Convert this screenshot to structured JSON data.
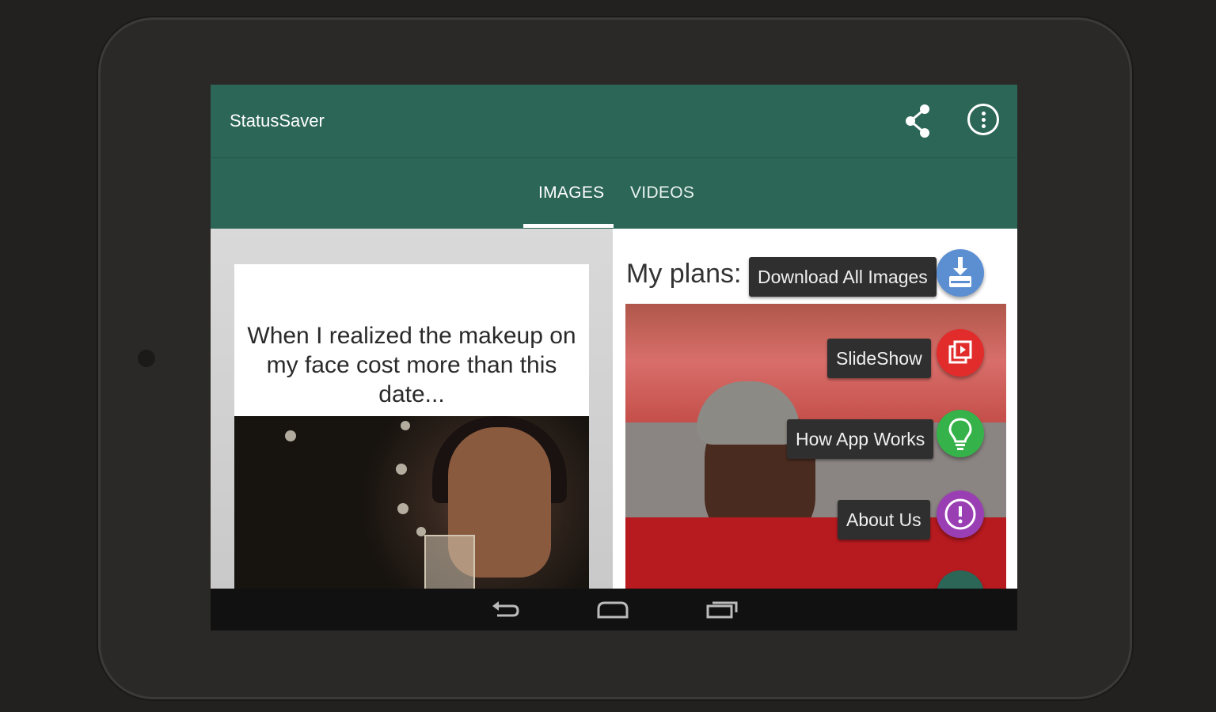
{
  "app": {
    "title": "StatusSaver",
    "accent_color": "#2c6657"
  },
  "toolbar": {
    "share_icon": "share-icon",
    "more_icon": "more-vert-icon"
  },
  "tabs": [
    {
      "label": "IMAGES",
      "selected": true
    },
    {
      "label": "VIDEOS",
      "selected": false
    }
  ],
  "cards": [
    {
      "caption": "When I realized the makeup on my face cost more than this date..."
    },
    {
      "caption": "My plans:"
    }
  ],
  "fab_menu": [
    {
      "label": "Download All Images",
      "icon": "download-icon",
      "color": "#5b8fd1"
    },
    {
      "label": "SlideShow",
      "icon": "slideshow-icon",
      "color": "#e22c2c"
    },
    {
      "label": "How App Works",
      "icon": "lightbulb-icon",
      "color": "#36b24a"
    },
    {
      "label": "About Us",
      "icon": "info-icon",
      "color": "#9a3fb3"
    }
  ],
  "system_nav": {
    "back_icon": "back-icon",
    "home_icon": "home-icon",
    "recents_icon": "recents-icon"
  }
}
